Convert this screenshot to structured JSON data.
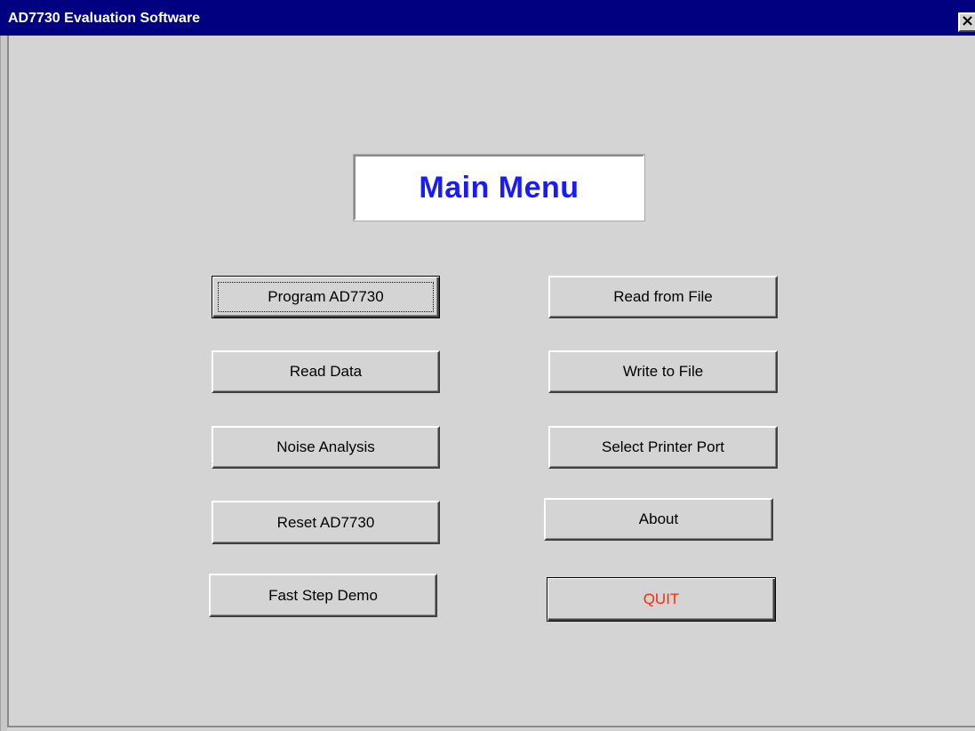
{
  "window": {
    "title": "AD7730 Evaluation Software",
    "close_glyph": "×"
  },
  "main": {
    "header": "Main Menu",
    "buttons": {
      "program": "Program AD7730",
      "read_data": "Read Data",
      "noise_analysis": "Noise Analysis",
      "reset": "Reset AD7730",
      "fast_step": "Fast Step Demo",
      "read_file": "Read from File",
      "write_file": "Write to File",
      "printer_port": "Select Printer Port",
      "about": "About",
      "quit": "QUIT"
    }
  },
  "colors": {
    "titlebar": "#000080",
    "header_text": "#1a1aff",
    "quit_text": "#ff2a00",
    "face": "#d4d4d4"
  },
  "icons": {
    "close": "close-icon"
  }
}
